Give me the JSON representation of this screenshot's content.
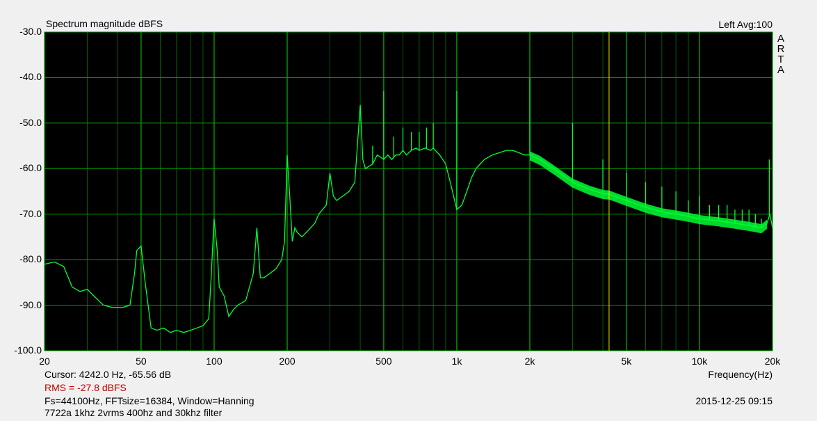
{
  "header": {
    "title": "Spectrum magnitude dBFS",
    "channel_info": "Left  Avg:100",
    "brand_letters": [
      "A",
      "R",
      "T",
      "A"
    ]
  },
  "footer": {
    "cursor_readout": "Cursor:  4242.0 Hz, -65.56 dB",
    "rms_readout": "RMS =  -27.8 dBFS",
    "params": "Fs=44100Hz, FFTsize=16384, Window=Hanning",
    "note": "7722a 1khz 2vrms 400hz and 30khz filter",
    "timestamp": "2015-12-25  09:15",
    "xlabel": "Frequency(Hz)"
  },
  "colors": {
    "plot_background": "#000000",
    "grid": "#00a000",
    "trace": "#00ff33",
    "cursor": "#e6e600",
    "rms_text": "#c00000",
    "page_background": "#f0f0f0"
  },
  "chart_data": {
    "type": "line",
    "title": "Spectrum magnitude dBFS",
    "xlabel": "Frequency(Hz)",
    "ylabel": "",
    "xscale": "log",
    "xlim": [
      20,
      20000
    ],
    "ylim": [
      -100,
      -30
    ],
    "grid": true,
    "x_ticks": [
      {
        "value": 20,
        "label": "20"
      },
      {
        "value": 50,
        "label": "50"
      },
      {
        "value": 100,
        "label": "100"
      },
      {
        "value": 200,
        "label": "200"
      },
      {
        "value": 500,
        "label": "500"
      },
      {
        "value": 1000,
        "label": "1k"
      },
      {
        "value": 2000,
        "label": "2k"
      },
      {
        "value": 5000,
        "label": "5k"
      },
      {
        "value": 10000,
        "label": "10k"
      },
      {
        "value": 20000,
        "label": "20k"
      }
    ],
    "y_ticks": [
      {
        "value": -30,
        "label": "-30.0"
      },
      {
        "value": -40,
        "label": "-40.0"
      },
      {
        "value": -50,
        "label": "-50.0"
      },
      {
        "value": -60,
        "label": "-60.0"
      },
      {
        "value": -70,
        "label": "-70.0"
      },
      {
        "value": -80,
        "label": "-80.0"
      },
      {
        "value": -90,
        "label": "-90.0"
      },
      {
        "value": -100,
        "label": "-100.0"
      }
    ],
    "cursor": {
      "x": 4242.0,
      "y": -65.56
    },
    "series": [
      {
        "points": [
          [
            20,
            -81
          ],
          [
            22,
            -80.5
          ],
          [
            24,
            -81.5
          ],
          [
            26,
            -86
          ],
          [
            28,
            -87
          ],
          [
            30,
            -86.5
          ],
          [
            32,
            -88
          ],
          [
            35,
            -90
          ],
          [
            38,
            -90.5
          ],
          [
            42,
            -90.5
          ],
          [
            45,
            -90
          ],
          [
            47,
            -83
          ],
          [
            48,
            -78
          ],
          [
            50,
            -77
          ],
          [
            52,
            -85
          ],
          [
            55,
            -95
          ],
          [
            58,
            -95.5
          ],
          [
            62,
            -95
          ],
          [
            66,
            -96
          ],
          [
            70,
            -95.5
          ],
          [
            75,
            -96
          ],
          [
            80,
            -95.5
          ],
          [
            85,
            -95
          ],
          [
            90,
            -94.5
          ],
          [
            95,
            -93
          ],
          [
            97,
            -85
          ],
          [
            100,
            -71
          ],
          [
            103,
            -78
          ],
          [
            105,
            -86
          ],
          [
            110,
            -88
          ],
          [
            115,
            -92.5
          ],
          [
            120,
            -91
          ],
          [
            125,
            -90
          ],
          [
            135,
            -89
          ],
          [
            145,
            -83
          ],
          [
            150,
            -73
          ],
          [
            155,
            -84
          ],
          [
            160,
            -84
          ],
          [
            170,
            -83
          ],
          [
            180,
            -82
          ],
          [
            190,
            -80
          ],
          [
            195,
            -76
          ],
          [
            200,
            -57
          ],
          [
            205,
            -66
          ],
          [
            210,
            -76
          ],
          [
            215,
            -73
          ],
          [
            220,
            -74
          ],
          [
            230,
            -75
          ],
          [
            240,
            -74
          ],
          [
            250,
            -73
          ],
          [
            260,
            -72
          ],
          [
            270,
            -70
          ],
          [
            290,
            -68
          ],
          [
            300,
            -61
          ],
          [
            310,
            -66
          ],
          [
            320,
            -67
          ],
          [
            340,
            -66
          ],
          [
            360,
            -65
          ],
          [
            380,
            -63
          ],
          [
            400,
            -46
          ],
          [
            410,
            -58
          ],
          [
            420,
            -60
          ],
          [
            450,
            -59
          ],
          [
            470,
            -57
          ],
          [
            500,
            -58
          ],
          [
            520,
            -57
          ],
          [
            540,
            -58
          ],
          [
            560,
            -57
          ],
          [
            580,
            -57
          ],
          [
            600,
            -56
          ],
          [
            620,
            -57
          ],
          [
            650,
            -56
          ],
          [
            680,
            -55.5
          ],
          [
            700,
            -56
          ],
          [
            740,
            -55.5
          ],
          [
            780,
            -56
          ],
          [
            800,
            -55.5
          ],
          [
            850,
            -57
          ],
          [
            900,
            -59
          ],
          [
            950,
            -64
          ],
          [
            1000,
            -69
          ],
          [
            1050,
            -68
          ],
          [
            1100,
            -65
          ],
          [
            1150,
            -62
          ],
          [
            1200,
            -60
          ],
          [
            1300,
            -58
          ],
          [
            1400,
            -57
          ],
          [
            1500,
            -56.5
          ],
          [
            1600,
            -56
          ],
          [
            1700,
            -56
          ],
          [
            1800,
            -56.5
          ],
          [
            1900,
            -57
          ],
          [
            2000,
            -57
          ],
          [
            2200,
            -58
          ],
          [
            2500,
            -60
          ],
          [
            3000,
            -63
          ],
          [
            3500,
            -64.5
          ],
          [
            4000,
            -65.5
          ],
          [
            4242,
            -65.6
          ],
          [
            5000,
            -67
          ],
          [
            6000,
            -68.5
          ],
          [
            7000,
            -69.5
          ],
          [
            8000,
            -70
          ],
          [
            9000,
            -70.5
          ],
          [
            10000,
            -71
          ],
          [
            12000,
            -71.5
          ],
          [
            14000,
            -72
          ],
          [
            16000,
            -72.5
          ],
          [
            18000,
            -73
          ],
          [
            19000,
            -72
          ],
          [
            19500,
            -70
          ],
          [
            20000,
            -73
          ]
        ],
        "spikes": [
          [
            400,
            -46
          ],
          [
            450,
            -55
          ],
          [
            500,
            -43
          ],
          [
            550,
            -53
          ],
          [
            600,
            -51
          ],
          [
            650,
            -52
          ],
          [
            700,
            -52
          ],
          [
            750,
            -51
          ],
          [
            800,
            -50
          ],
          [
            1000,
            -43
          ],
          [
            2000,
            -40
          ],
          [
            3000,
            -50
          ],
          [
            4000,
            -58
          ],
          [
            5000,
            -61
          ],
          [
            6000,
            -63
          ],
          [
            7000,
            -64
          ],
          [
            8000,
            -65
          ],
          [
            9000,
            -67
          ],
          [
            10000,
            -66
          ],
          [
            11000,
            -68
          ],
          [
            12000,
            -68
          ],
          [
            13000,
            -68
          ],
          [
            14000,
            -69
          ],
          [
            15000,
            -69
          ],
          [
            16000,
            -69
          ],
          [
            17000,
            -70
          ],
          [
            18000,
            -71
          ],
          [
            19400,
            -58
          ]
        ]
      }
    ]
  }
}
